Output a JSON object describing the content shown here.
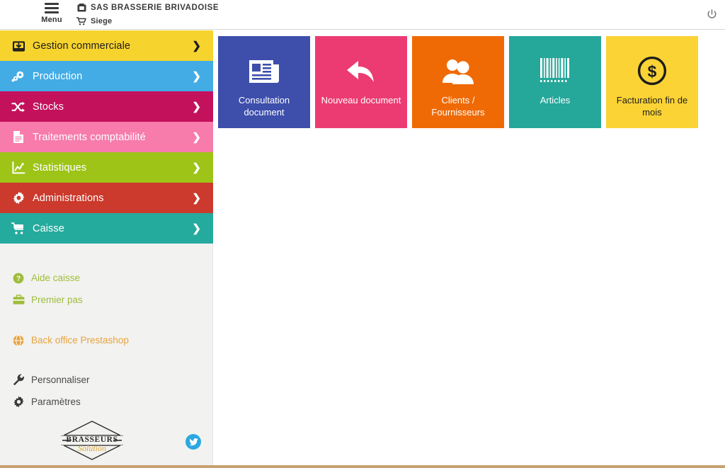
{
  "header": {
    "menu_label": "Menu",
    "menu_icon": "hamburger-icon",
    "company_icon": "building-icon",
    "company_name": "SAS BRASSERIE BRIVADOISE",
    "site_icon": "shopping-cart-icon",
    "site_name": "Siege",
    "power_icon": "power-icon"
  },
  "sidebar": {
    "nav_items": [
      {
        "label": "Gestion commerciale",
        "icon": "inbox-download-icon",
        "bg": "#f7d32e",
        "text_dark": true,
        "chevron": "❯"
      },
      {
        "label": "Production",
        "icon": "gears-icon",
        "bg": "#43ace5",
        "text_dark": false,
        "chevron": "❯"
      },
      {
        "label": "Stocks",
        "icon": "shuffle-icon",
        "bg": "#c4115c",
        "text_dark": false,
        "chevron": "❯"
      },
      {
        "label": "Traitements comptabilité",
        "icon": "document-icon",
        "bg": "#f77bab",
        "text_dark": false,
        "chevron": "❯"
      },
      {
        "label": "Statistiques",
        "icon": "chart-line-icon",
        "bg": "#9ec417",
        "text_dark": false,
        "chevron": "❯"
      },
      {
        "label": "Administrations",
        "icon": "gear-icon",
        "bg": "#cb3a2c",
        "text_dark": false,
        "chevron": "❯"
      },
      {
        "label": "Caisse",
        "icon": "cash-cart-icon",
        "bg": "#25ab9d",
        "text_dark": false,
        "chevron": "❯"
      }
    ],
    "help_links": [
      {
        "label": "Aide caisse",
        "icon": "question-circle-icon",
        "color": "#9fbd3b"
      },
      {
        "label": "Premier pas",
        "icon": "briefcase-icon",
        "color": "#9fbd3b"
      }
    ],
    "external_links": [
      {
        "label": "Back office Prestashop",
        "icon": "globe-icon",
        "color": "#e8a33d"
      }
    ],
    "settings_links": [
      {
        "label": "Personnaliser",
        "icon": "wrench-icon",
        "color": "#4a4a4a"
      },
      {
        "label": "Paramètres",
        "icon": "gear-icon",
        "color": "#4a4a4a"
      }
    ],
    "logo": {
      "brand_name": "BRASSEURS",
      "brand_sub": "Solution"
    },
    "social": {
      "twitter_icon": "twitter-icon",
      "twitter_color": "#2ca8e0"
    }
  },
  "main": {
    "tiles": [
      {
        "label": "Consultation document",
        "icon": "newspaper-icon",
        "bg": "#3d4eab",
        "text_dark": false
      },
      {
        "label": "Nouveau document",
        "icon": "reply-arrow-icon",
        "bg": "#ec3b72",
        "text_dark": false
      },
      {
        "label": "Clients / Fournisseurs",
        "icon": "users-icon",
        "bg": "#ef6a05",
        "text_dark": false
      },
      {
        "label": "Articles",
        "icon": "barcode-icon",
        "bg": "#25a79a",
        "text_dark": false
      },
      {
        "label": "Facturation fin de mois",
        "icon": "dollar-circle-icon",
        "bg": "#fbd335",
        "text_dark": true
      }
    ]
  }
}
